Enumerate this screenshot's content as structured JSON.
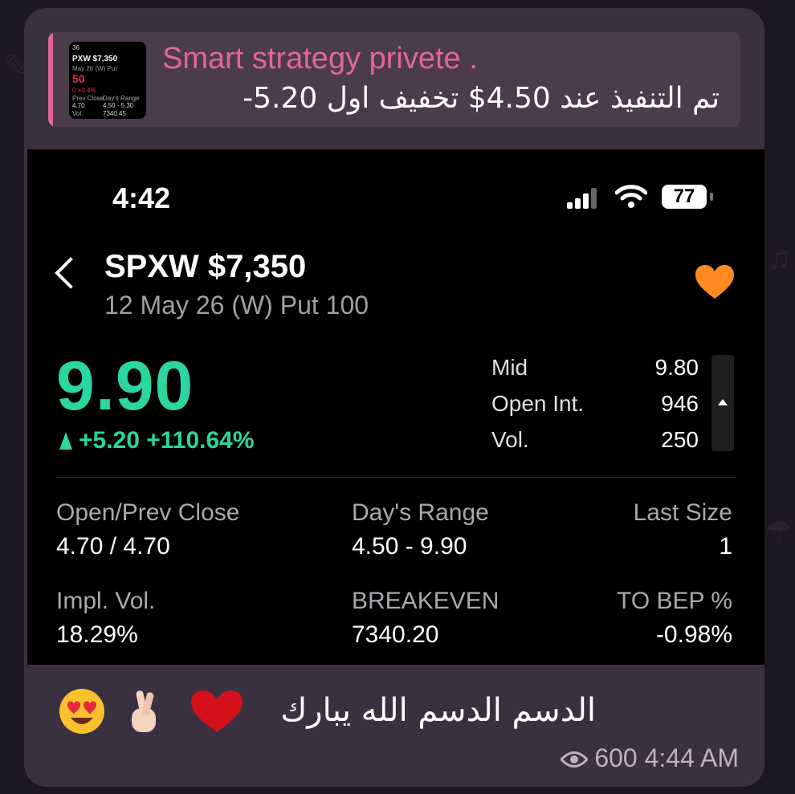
{
  "reply": {
    "title": "Smart strategy privete .",
    "text": "تم التنفيذ عند 4.50$ تخفيف اول 5.20-",
    "thumbnail": {
      "time": "36",
      "symbol": "PXW $7,350",
      "sub": "May 26 (W) Put",
      "price": "50",
      "change": "0 +0.4%",
      "labels": [
        "Prev Close",
        "Day's Range",
        "4.70",
        "4.50 - 5.30",
        "Vol.",
        "BREAKEVEN",
        "7340.45"
      ]
    }
  },
  "status_bar": {
    "time": "4:42",
    "battery": "77"
  },
  "quote": {
    "symbol": "SPXW $7,350",
    "subtitle": "12 May 26 (W) Put 100",
    "price": "9.90",
    "change": "+5.20 +110.64%",
    "stats": [
      {
        "label": "Mid",
        "value": "9.80"
      },
      {
        "label": "Open Int.",
        "value": "946"
      },
      {
        "label": "Vol.",
        "value": "250"
      }
    ],
    "grid": [
      {
        "label": "Open/Prev Close",
        "value": "4.70 / 4.70"
      },
      {
        "label": "Day's Range",
        "value": "4.50 - 9.90"
      },
      {
        "label": "Last Size",
        "value": "1"
      },
      {
        "label": "Impl. Vol.",
        "value": "18.29%"
      },
      {
        "label": "BREAKEVEN",
        "value": "7340.20"
      },
      {
        "label": "TO BEP %",
        "value": "-0.98%"
      }
    ]
  },
  "message": {
    "caption": "الدسم الدسم الله يبارك",
    "emojis": [
      "heart-eyes-emoji",
      "crossed-fingers-emoji",
      "red-heart-emoji"
    ],
    "views": "600",
    "time": "4:44 AM"
  },
  "colors": {
    "accent_pink": "#e4649c",
    "up_green": "#2bd6a0",
    "heart_orange": "#ff8a1f"
  }
}
